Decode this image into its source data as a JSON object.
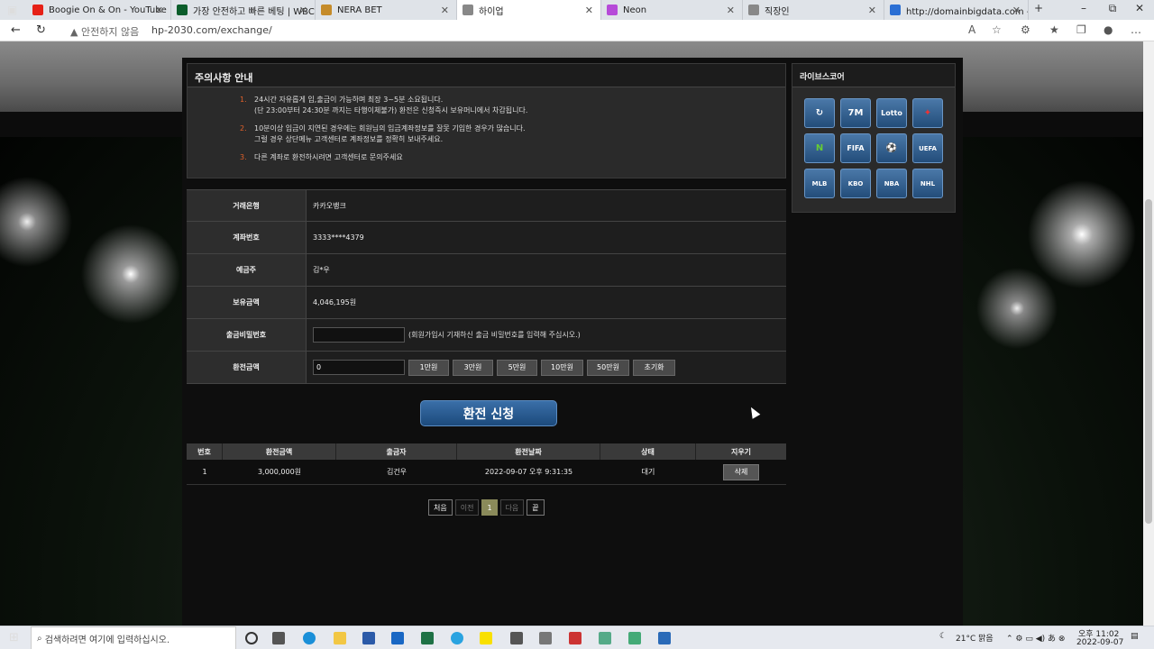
{
  "browser": {
    "tabs": [
      {
        "title": "Boogie On & On - YouTube",
        "color": "#e62117"
      },
      {
        "title": "가장 안전하고 빠른 베팅 | WBC:",
        "color": "#0b5d2b"
      },
      {
        "title": "NERA BET",
        "color": "#c58b2a"
      },
      {
        "title": "하이업",
        "color": "#888888"
      },
      {
        "title": "Neon",
        "color": "#b64ad8"
      },
      {
        "title": "직장인",
        "color": "#888888"
      },
      {
        "title": "http://domainbigdata.com - 검",
        "color": "#2b6fd4"
      }
    ],
    "security_label": "안전하지 않음",
    "url": "hp-2030.com/exchange/"
  },
  "notice": {
    "title": "주의사항 안내",
    "items": [
      {
        "num": "1.",
        "line1": "24시간 자유롭게 입,출금이 가능하며 최장 3~5분 소요됩니다.",
        "line2": "(단 23:00부터 24:30분 까지는 타행이체불가) 환전은 신청즉시 보유머니에서 차감됩니다."
      },
      {
        "num": "2.",
        "line1": "10분이상 입금이 지연된 경우에는 회원님의 입금계좌정보를 잘못 기입한 경우가 많습니다.",
        "line2": "그럴 경우 상단메뉴 고객센터로 계좌정보를 정확히 보내주세요."
      },
      {
        "num": "3.",
        "line1": "다른 계좌로 환전하시려면 고객센터로 문의주세요",
        "line2": ""
      }
    ]
  },
  "form": {
    "bank_label": "거래은행",
    "bank_value": "카카오뱅크",
    "account_label": "계좌번호",
    "account_value": "3333****4379",
    "holder_label": "예금주",
    "holder_value": "김*우",
    "balance_label": "보유금액",
    "balance_value": "4,046,195원",
    "password_label": "출금비밀번호",
    "password_hint": "(회원가입시 기재하신 출금 비밀번호를 입력해 주십시오.)",
    "amount_label": "환전금액",
    "amount_value": "0",
    "amount_buttons": [
      "1만원",
      "3만원",
      "5만원",
      "10만원",
      "50만원",
      "초기화"
    ],
    "submit_label": "환전 신청"
  },
  "history": {
    "headers": [
      "번호",
      "환전금액",
      "출금자",
      "환전날짜",
      "상태",
      "지우기"
    ],
    "rows": [
      {
        "no": "1",
        "amount": "3,000,000원",
        "name": "김건우",
        "date": "2022-09-07 오후 9:31:35",
        "status": "대기",
        "action": "삭제"
      }
    ]
  },
  "pagination": {
    "first": "처음",
    "prev": "이전",
    "current": "1",
    "next": "다음",
    "last": "끝"
  },
  "live": {
    "title": "라이브스코어",
    "icons": [
      "score-icon",
      "7m-icon",
      "lotto-icon",
      "puzzle-icon",
      "naver-icon",
      "fifa-icon",
      "champions-icon",
      "uefa-icon",
      "mlb-icon",
      "kbo-icon",
      "nba-icon",
      "nhl-icon"
    ],
    "labels": [
      "↻",
      "7M",
      "Lotto",
      "✦",
      "N",
      "FIFA",
      "⚽",
      "UEFA",
      "MLB",
      "KBO",
      "NBA",
      "NHL"
    ]
  },
  "taskbar": {
    "search_placeholder": "검색하려면 여기에 입력하십시오.",
    "weather": "21°C 맑음",
    "time": "오후 11:02",
    "date": "2022-09-07"
  }
}
